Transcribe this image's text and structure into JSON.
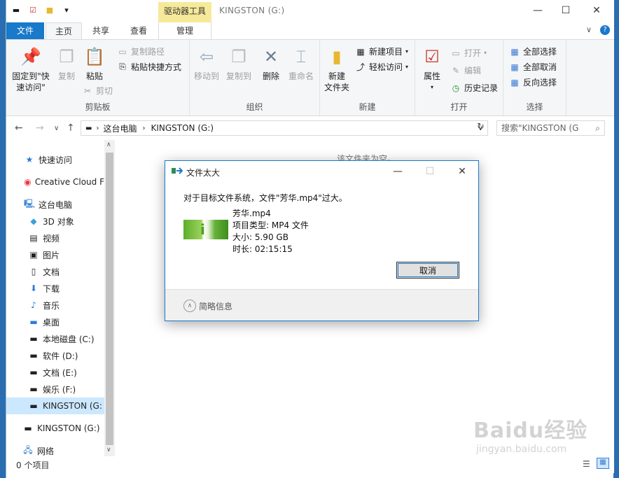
{
  "window": {
    "title": "KINGSTON (G:)",
    "context_tab": "驱动器工具",
    "minimize": "—",
    "maximize": "☐",
    "close": "✕"
  },
  "tabs": {
    "file": "文件",
    "home": "主页",
    "share": "共享",
    "view": "查看",
    "manage": "管理"
  },
  "ribbon": {
    "clipboard": {
      "label": "剪贴板",
      "pin": "固定到\"快速访问\"",
      "copy": "复制",
      "paste": "粘贴",
      "copy_path": "复制路径",
      "paste_shortcut": "粘贴快捷方式",
      "cut": "剪切"
    },
    "organize": {
      "label": "组织",
      "move_to": "移动到",
      "copy_to": "复制到",
      "delete": "删除",
      "rename": "重命名"
    },
    "new": {
      "label": "新建",
      "new_folder_1": "新建",
      "new_folder_2": "文件夹",
      "new_item": "新建项目",
      "easy_access": "轻松访问"
    },
    "open": {
      "label": "打开",
      "properties": "属性",
      "open": "打开",
      "edit": "编辑",
      "history": "历史记录"
    },
    "select": {
      "label": "选择",
      "select_all": "全部选择",
      "select_none": "全部取消",
      "invert": "反向选择"
    }
  },
  "address": {
    "this_pc": "这台电脑",
    "current": "KINGSTON (G:)",
    "search_placeholder": "搜索\"KINGSTON (G"
  },
  "nav": {
    "items": [
      {
        "label": "快速访问",
        "icon": "star-icon"
      },
      {
        "label": "Creative Cloud F",
        "icon": "creative-cloud-icon"
      },
      {
        "label": "这台电脑",
        "icon": "computer-icon"
      },
      {
        "label": "3D 对象",
        "icon": "cube-icon"
      },
      {
        "label": "视频",
        "icon": "video-icon"
      },
      {
        "label": "图片",
        "icon": "picture-icon"
      },
      {
        "label": "文档",
        "icon": "document-icon"
      },
      {
        "label": "下载",
        "icon": "download-icon"
      },
      {
        "label": "音乐",
        "icon": "music-icon"
      },
      {
        "label": "桌面",
        "icon": "desktop-icon"
      },
      {
        "label": "本地磁盘 (C:)",
        "icon": "drive-icon"
      },
      {
        "label": "软件 (D:)",
        "icon": "drive-icon"
      },
      {
        "label": "文档 (E:)",
        "icon": "drive-icon"
      },
      {
        "label": "娱乐 (F:)",
        "icon": "drive-icon"
      },
      {
        "label": "KINGSTON (G:",
        "icon": "usb-drive-icon"
      },
      {
        "label": "KINGSTON (G:)",
        "icon": "usb-drive-icon"
      },
      {
        "label": "网络",
        "icon": "network-icon"
      }
    ]
  },
  "content": {
    "empty_text": "该文件夹为空。"
  },
  "status": {
    "items": "0 个项目"
  },
  "dialog": {
    "title": "文件太大",
    "message": "对于目标文件系统，文件\"芳华.mp4\"过大。",
    "filename": "芳华.mp4",
    "type": "项目类型: MP4 文件",
    "size": "大小: 5.90 GB",
    "duration": "时长: 02:15:15",
    "cancel": "取消",
    "less_info": "简略信息"
  },
  "watermark": {
    "brand": "Baidu经验",
    "url": "jingyan.baidu.com"
  }
}
